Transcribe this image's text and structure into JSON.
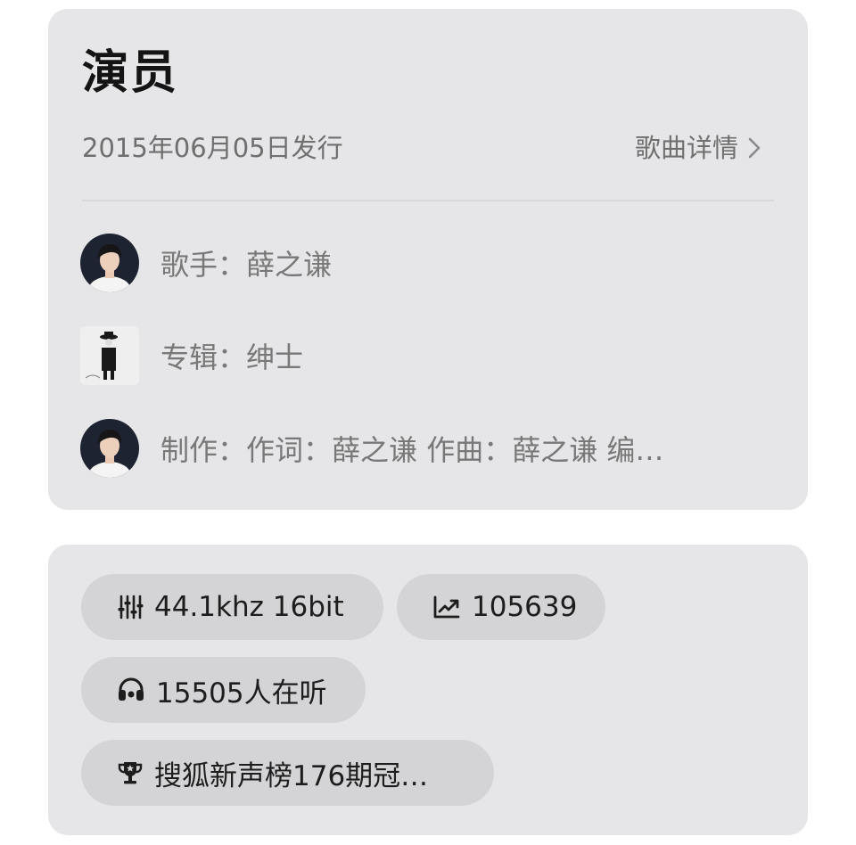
{
  "song": {
    "title": "演员",
    "release_date": "2015年06月05日发行",
    "detail_link": "歌曲详情"
  },
  "info_rows": {
    "singer": {
      "label": "歌手：",
      "value": "薛之谦",
      "icon": "singer-avatar"
    },
    "album": {
      "label": "专辑：",
      "value": "绅士",
      "icon": "album-cover"
    },
    "credits": {
      "label": "制作：",
      "value": "作词：薛之谦  作曲：薛之谦  编…",
      "icon": "producer-avatar"
    }
  },
  "stats": {
    "quality": {
      "text": "44.1khz  16bit",
      "icon": "equalizer-icon"
    },
    "plays": {
      "text": "105639",
      "icon": "trending-up-icon"
    },
    "listeners": {
      "text": "15505人在听",
      "icon": "headphones-icon"
    },
    "chart": {
      "text": "搜狐新声榜176期冠…",
      "icon": "trophy-icon"
    }
  },
  "colors": {
    "card_background": "#e6e6e8",
    "chip_background": "#d4d4d6",
    "title_text": "#141414",
    "secondary_text": "#6f6f6f"
  }
}
